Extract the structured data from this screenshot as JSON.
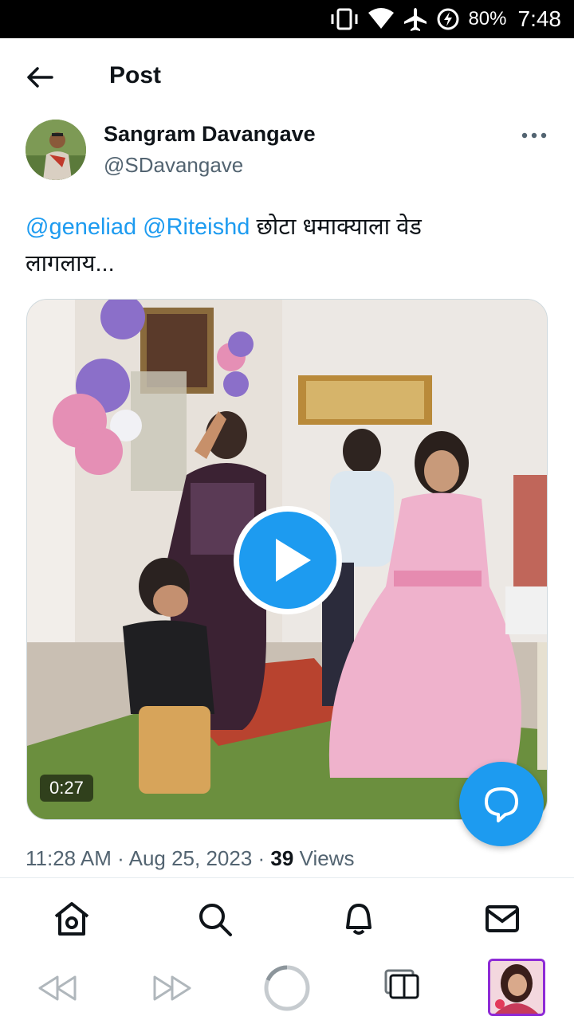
{
  "status_bar": {
    "battery": "80%",
    "time": "7:48",
    "icons": [
      "vibrate-icon",
      "wifi-icon",
      "airplane-icon",
      "battery-saver-icon"
    ]
  },
  "header": {
    "title": "Post",
    "back_icon": "arrow-left-icon"
  },
  "author": {
    "name": "Sangram Davangave",
    "handle": "@SDavangave",
    "more_icon": "more-horizontal-icon"
  },
  "tweet": {
    "mention_1": "@geneliad",
    "mention_2": "@Riteishd",
    "text_line_1": " छोटा धमाक्याला वेड",
    "text_line_2": "लागलाय..."
  },
  "media": {
    "type": "video",
    "duration": "0:27",
    "play_icon": "play-icon"
  },
  "meta": {
    "time": "11:28 AM",
    "separator": " · ",
    "date": "Aug 25, 2023",
    "views_count": "39",
    "views_label": " Views"
  },
  "fab": {
    "icon": "compose-reply-icon"
  },
  "bottom_nav": {
    "items": [
      "home-icon",
      "search-icon",
      "notifications-icon",
      "messages-icon"
    ]
  },
  "browser_bar": {
    "items": [
      "back-icon",
      "forward-icon",
      "reload-icon",
      "tabs-icon",
      "profile-thumbnail"
    ]
  },
  "colors": {
    "accent": "#1d9bf0",
    "text": "#0f1419",
    "secondary_text": "#536471"
  }
}
